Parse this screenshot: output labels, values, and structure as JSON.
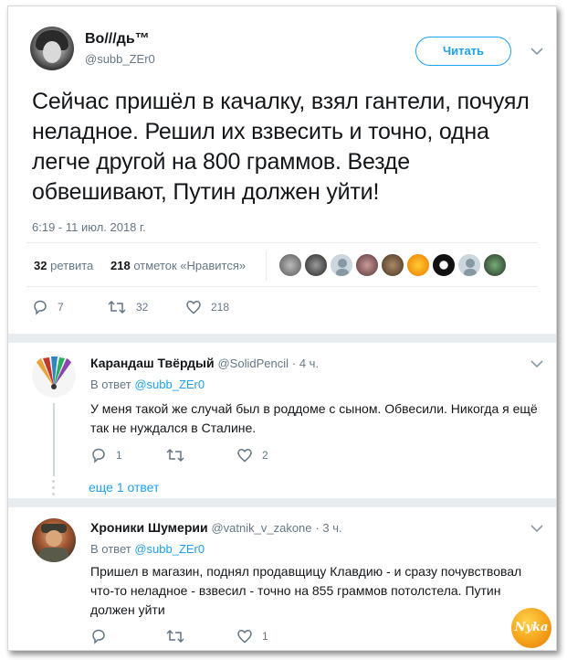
{
  "main_tweet": {
    "author_name": "Во///дь™",
    "author_handle": "@subb_ZEr0",
    "follow_label": "Читать",
    "text": "Сейчас пришёл в качалку, взял гантели, почуял неладное. Решил их взвесить и точно, одна легче другой на 800 граммов. Везде обвешивают, Путин должен уйти!",
    "timestamp": "6:19 - 11 июл. 2018 г.",
    "retweets_count": "32",
    "retweets_label": "ретвита",
    "likes_count": "218",
    "likes_label": "отметок «Нравится»",
    "actions": {
      "replies": "7",
      "retweets": "32",
      "likes": "218"
    }
  },
  "replies": [
    {
      "name": "Карандаш Твёрдый",
      "handle": "@SolidPencil",
      "time": "· 4 ч.",
      "reply_to_label": "В ответ",
      "reply_to_handle": "@subb_ZEr0",
      "text": "У меня такой же случай был в роддоме с сыном. Обвесили. Никогда я ещё так не нуждался в Сталине.",
      "actions": {
        "replies": "1",
        "retweets": "",
        "likes": "2"
      },
      "more_label": "еще 1 ответ"
    },
    {
      "name": "Хроники Шумерии",
      "handle": "@vatnik_v_zakone",
      "time": "· 3 ч.",
      "reply_to_label": "В ответ",
      "reply_to_handle": "@subb_ZEr0",
      "text": "Пришел в магазин, поднял продавщицу Клавдию - и сразу почувствовал что-то неладное - взвесил - точно на 855 граммов потолстела. Путин должен уйти",
      "actions": {
        "replies": "",
        "retweets": "",
        "likes": "1"
      }
    }
  ],
  "watermark": "Nyka",
  "colors": {
    "accent": "#1da1f2",
    "muted": "#657786",
    "text": "#14171a",
    "border": "#e6ecf0"
  }
}
